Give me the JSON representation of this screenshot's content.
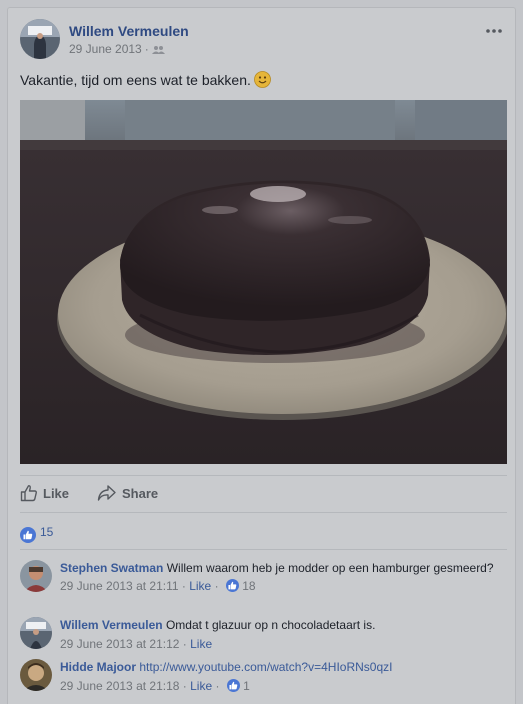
{
  "post": {
    "author": "Willem Vermeulen",
    "date": "29 June 2013",
    "audience_icon": "friends-icon",
    "text": "Vakantie, tijd om eens wat te bakken.",
    "emoji": "smile-emoji"
  },
  "actions": {
    "like_label": "Like",
    "share_label": "Share"
  },
  "reactions": {
    "count": "15"
  },
  "comments": [
    {
      "author": "Stephen Swatman",
      "text": "Willem waarom heb je modder op een hamburger gesmeerd?",
      "time": "29 June 2013 at 21:11",
      "like_label": "Like",
      "likes": "18"
    },
    {
      "author": "Willem Vermeulen",
      "text": "Omdat t glazuur op n chocoladetaart is.",
      "time": "29 June 2013 at 21:12",
      "like_label": "Like",
      "likes": ""
    },
    {
      "author": "Hidde Majoor",
      "text": "http://www.youtube.com/watch?v=4HIoRNs0qzI",
      "time": "29 June 2013 at 21:18",
      "like_label": "Like",
      "likes": "1"
    }
  ],
  "colors": {
    "background": "#c9cbce",
    "link_blue": "#3a5a98",
    "like_blue": "#4a76d4"
  }
}
